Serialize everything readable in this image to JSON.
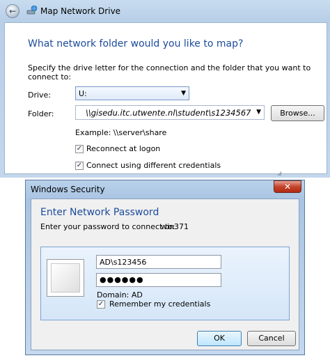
{
  "map_drive": {
    "title": "Map Network Drive",
    "heading": "What network folder would you like to map?",
    "instruction": "Specify the drive letter for the connection and the folder that you want to connect to:",
    "drive_label": "Drive:",
    "drive_value": "U:",
    "folder_label": "Folder:",
    "folder_value": "\\\\gisedu.itc.utwente.nl\\student\\s1234567",
    "browse_label": "Browse...",
    "example": "Example: \\\\server\\share",
    "reconnect_label": "Reconnect at logon",
    "reconnect_checked": true,
    "creds_label": "Connect using different credentials",
    "creds_checked": true
  },
  "security": {
    "title": "Windows Security",
    "heading": "Enter Network Password",
    "instruction": "Enter your password to connect to:",
    "server": "win371",
    "username": "AD\\s123456",
    "password_mask": "●●●●●●",
    "domain": "Domain: AD",
    "remember_label": "Remember my credentials",
    "remember_checked": true,
    "ok_label": "OK",
    "cancel_label": "Cancel"
  },
  "icons": {
    "back": "back-arrow-icon",
    "map_drive": "network-drive-icon",
    "close": "close-icon",
    "check": "checkmark-icon",
    "dropdown": "chevron-down-icon",
    "user": "user-tile-icon"
  },
  "colors": {
    "heading_blue": "#1c4b9c",
    "close_red": "#c4442c"
  }
}
